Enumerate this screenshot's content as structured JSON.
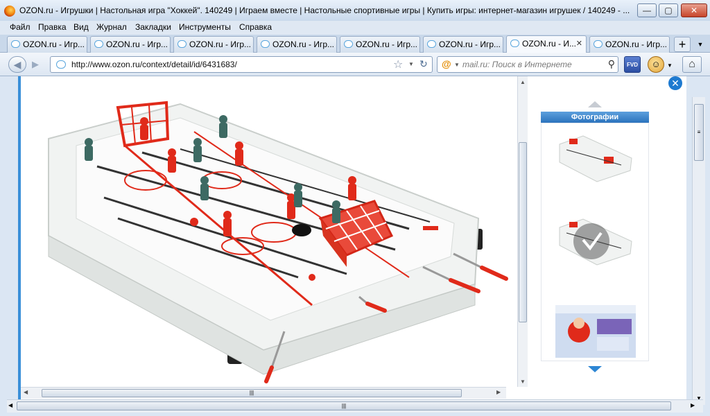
{
  "window": {
    "title": "OZON.ru - Игрушки | Настольная игра \"Хоккей\". 140249 | Играем вместе | Настольные спортивные игры | Купить игры: интернет-магазин игрушек / 140249 - ...",
    "minimize_glyph": "—",
    "maximize_glyph": "▢",
    "close_glyph": "✕"
  },
  "menu": [
    "Файл",
    "Правка",
    "Вид",
    "Журнал",
    "Закладки",
    "Инструменты",
    "Справка"
  ],
  "tabs": [
    {
      "label": "OZON.ru - Игр...",
      "active": false
    },
    {
      "label": "OZON.ru - Игр...",
      "active": false
    },
    {
      "label": "OZON.ru - Игр...",
      "active": false
    },
    {
      "label": "OZON.ru - Игр...",
      "active": false
    },
    {
      "label": "OZON.ru - Игр...",
      "active": false
    },
    {
      "label": "OZON.ru - Игр...",
      "active": false
    },
    {
      "label": "OZON.ru - И...",
      "active": true,
      "close": "✕"
    },
    {
      "label": "OZON.ru - Игр...",
      "active": false
    }
  ],
  "new_tab_glyph": "+",
  "nav": {
    "back_glyph": "◀",
    "forward_glyph": "▶",
    "url": "http://www.ozon.ru/context/detail/id/6431683/",
    "star_glyph": "☆",
    "reload_glyph": "↻",
    "search_placeholder": "mail.ru: Поиск в Интернете",
    "search_engine_glyph": "@",
    "search_go_glyph": "⚲",
    "fvd_label": "FVD",
    "home_glyph": "⌂",
    "smiley_glyph": "☺"
  },
  "viewer": {
    "close_glyph": "✕",
    "photos_header": "Фотографии"
  },
  "colors": {
    "accent": "#2b73bd",
    "brand_red": "#e02a1a",
    "table_white": "#f4f5f4"
  }
}
